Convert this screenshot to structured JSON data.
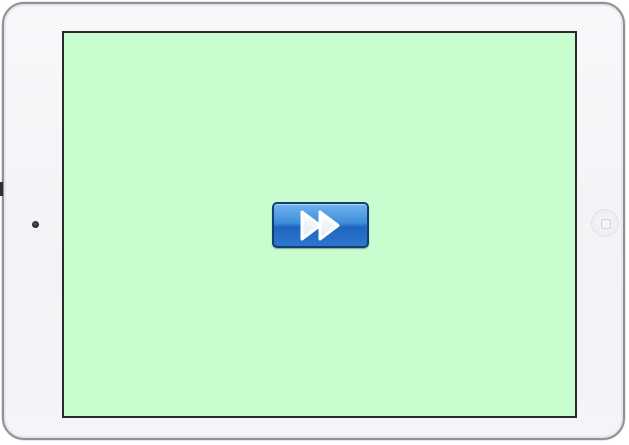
{
  "device": {
    "type": "tablet",
    "orientation": "landscape"
  },
  "screen": {
    "background_color": "#c8fdd0"
  },
  "center_button": {
    "icon": "fast-forward-icon",
    "color": "#2f7fd3"
  }
}
